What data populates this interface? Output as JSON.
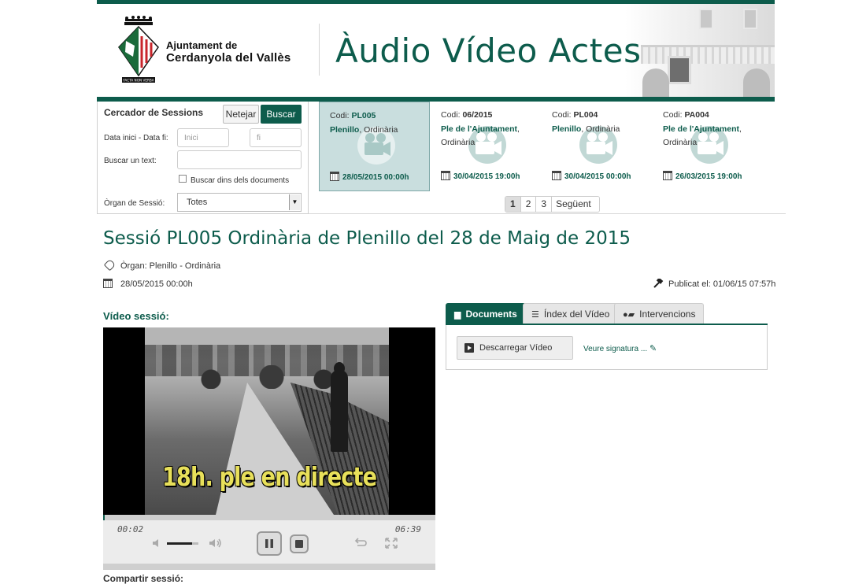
{
  "header": {
    "logo_line1": "Ajuntament de",
    "logo_line2": "Cerdanyola del Vallès",
    "site_title": "Àudio Vídeo Actes"
  },
  "search": {
    "title": "Cercador de Sessions",
    "clear_label": "Netejar",
    "search_label": "Buscar",
    "date_label": "Data inici - Data fi:",
    "start_placeholder": "Inici",
    "end_placeholder": "fi",
    "text_label": "Buscar un text:",
    "text_value": "",
    "docs_checkbox_label": "Buscar dins dels documents",
    "organ_label": "Òrgan de Sessió:",
    "organ_value": "Totes"
  },
  "sessions": [
    {
      "code_label": "Codi:",
      "code": "PL005",
      "organ": "Plenillo",
      "type": ", Ordinària",
      "date": "28/05/2015 00:00h",
      "active": true
    },
    {
      "code_label": "Codi:",
      "code": "06/2015",
      "organ": "Ple de l'Ajuntament",
      "type": ", Ordinària",
      "date": "30/04/2015 19:00h",
      "active": false
    },
    {
      "code_label": "Codi:",
      "code": "PL004",
      "organ": "Plenillo",
      "type": ", Ordinària",
      "date": "30/04/2015 00:00h",
      "active": false
    },
    {
      "code_label": "Codi:",
      "code": "PA004",
      "organ": "Ple de l'Ajuntament",
      "type": ", Ordinària",
      "date": "26/03/2015 19:00h",
      "active": false
    }
  ],
  "pager": {
    "pages": [
      "1",
      "2",
      "3"
    ],
    "next_label": "Següent"
  },
  "session": {
    "title": "Sessió PL005 Ordinària de Plenillo del 28 de Maig de 2015",
    "organ_line": "Òrgan: Plenillo -  Ordinària",
    "date": "28/05/2015 00:00h",
    "published": "Publicat el: 01/06/15 07:57h"
  },
  "video": {
    "label": "Vídeo sessió:",
    "caption": "18h. ple en directe",
    "current_time": "00:02",
    "duration": "06:39",
    "progress_fraction": 0.005,
    "volume_fraction": 0.8
  },
  "tabs": [
    {
      "label": "Documents",
      "icon": "document-icon",
      "active": true
    },
    {
      "label": "Índex del Vídeo",
      "icon": "list-icon",
      "active": false
    },
    {
      "label": "Intervencions",
      "icon": "user-chat-icon",
      "active": false
    }
  ],
  "documents": {
    "download_label": "Descarregar Vídeo",
    "signature_label": "Veure signatura ..."
  },
  "share_label": "Compartir sessió:",
  "colors": {
    "brand": "#0d5c4c",
    "active_card": "#c9dede"
  }
}
